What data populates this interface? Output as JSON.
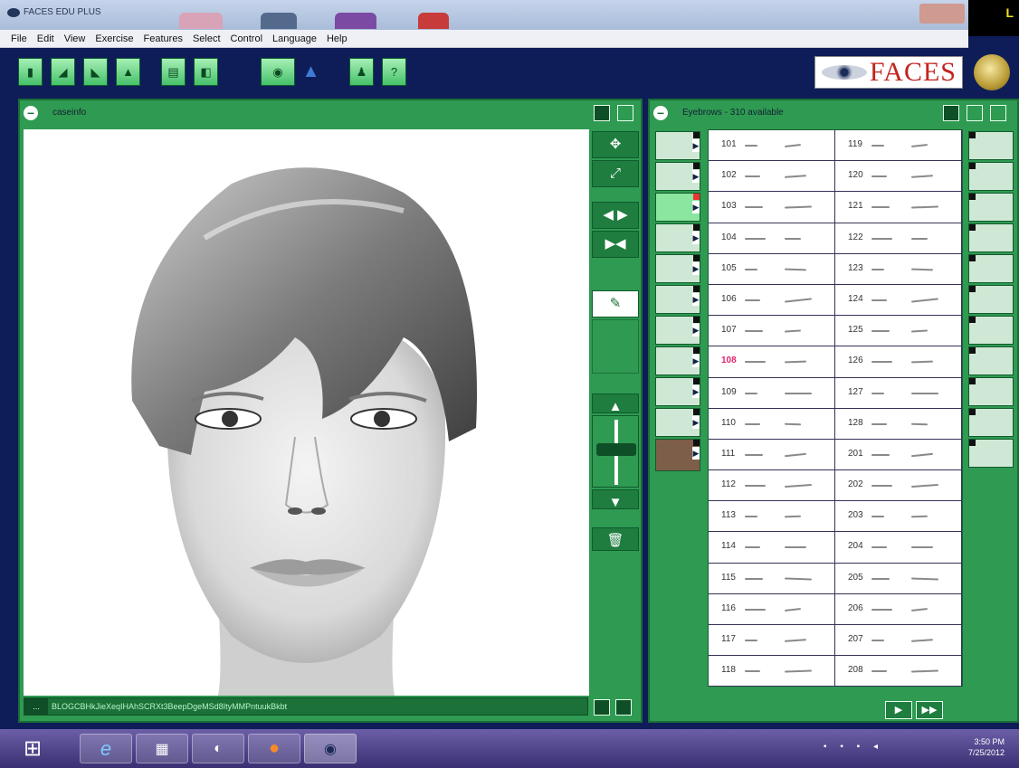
{
  "window": {
    "title": "FACES EDU PLUS",
    "corner_text": "L"
  },
  "menu": [
    "File",
    "Edit",
    "View",
    "Exercise",
    "Features",
    "Select",
    "Control",
    "Language",
    "Help"
  ],
  "toolbar": {
    "buttons": [
      "new-icon",
      "open-icon",
      "save-icon",
      "export-icon",
      "print-icon",
      "copy-icon",
      "view-icon",
      "hat-icon",
      "person-icon",
      "help-icon"
    ],
    "logo_text": "FACES"
  },
  "left_panel": {
    "title": "caseinfo"
  },
  "right_panel": {
    "title": "Eyebrows - 310 available"
  },
  "status": {
    "dots": "...",
    "code": "BLOGCBHkJieXeqIHAhSCRXt3BeepDgeMSd8ItyMMPntuukBkbt"
  },
  "grid": {
    "left": [
      "101",
      "102",
      "103",
      "104",
      "105",
      "106",
      "107",
      "108",
      "109",
      "110",
      "111",
      "112",
      "113",
      "114",
      "115",
      "116",
      "117",
      "118"
    ],
    "right": [
      "119",
      "120",
      "121",
      "122",
      "123",
      "124",
      "125",
      "126",
      "127",
      "128",
      "201",
      "202",
      "203",
      "204",
      "205",
      "206",
      "207",
      "208"
    ],
    "selected": "108"
  },
  "nav": {
    "next": "▶",
    "last": "▶▶"
  },
  "taskbar": {
    "time": "3:50 PM",
    "date": "7/25/2012"
  },
  "colors": {
    "panel_green": "#2f9a52",
    "dark_bg": "#0e1d58",
    "selected_number": "#e0246a"
  }
}
